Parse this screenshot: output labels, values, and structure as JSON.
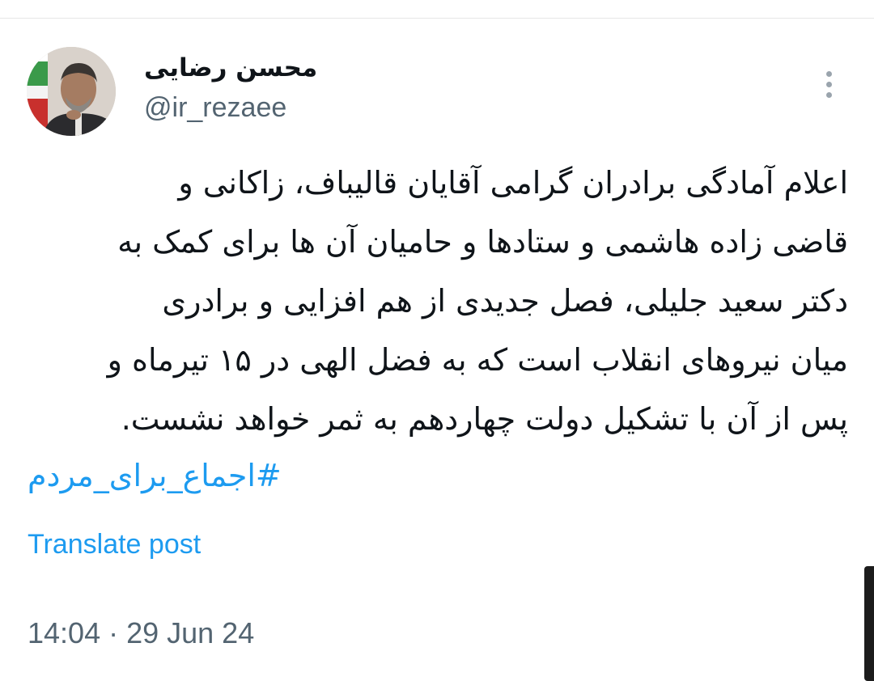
{
  "post": {
    "author_name": "محسن رضایی",
    "author_handle": "@ir_rezaee",
    "body_lines": [
      "اعلام آمادگی برادران گرامی آقایان قالیباف، زاکانی و",
      "قاضی زاده هاشمی و ستادها و حامیان آن ها برای کمک به",
      "دکتر سعید جلیلی، فصل جدیدی از هم افزایی و برادری",
      "میان نیروهای انقلاب است که به فضل الهی در ۱۵ تیرماه و",
      "پس از آن با تشکیل دولت چهاردهم به ثمر خواهد نشست."
    ],
    "hashtag": "#اجماع_برای_مردم",
    "translate_label": "Translate post",
    "timestamp": "14:04 · 29 Jun 24"
  },
  "icons": {
    "avatar": "profile-photo",
    "more": "more-vertical-icon"
  },
  "colors": {
    "link": "#1d9bf0",
    "secondary_text": "#536471",
    "primary_text": "#0f1419"
  }
}
